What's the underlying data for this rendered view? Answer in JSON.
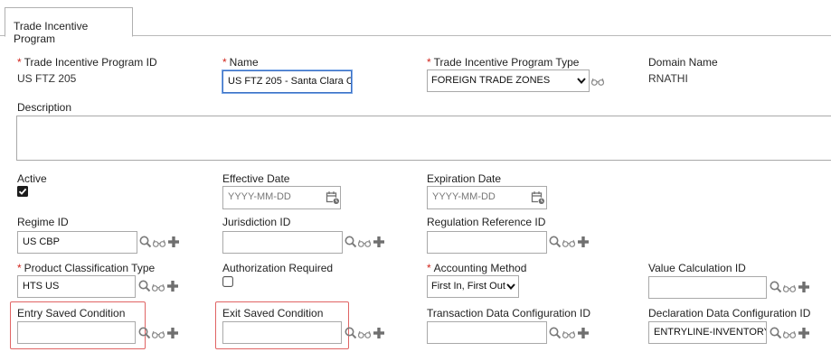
{
  "tabs": [
    {
      "label": "Trade Incentive Program"
    }
  ],
  "fields": {
    "program_id": {
      "label": "Trade Incentive Program ID",
      "value": "US FTZ 205"
    },
    "name": {
      "label": "Name",
      "value": "US FTZ 205 - Santa Clara C"
    },
    "program_type": {
      "label": "Trade Incentive Program Type",
      "value": "FOREIGN TRADE ZONES"
    },
    "domain_name": {
      "label": "Domain Name",
      "value": "RNATHI"
    },
    "description": {
      "label": "Description",
      "value": ""
    },
    "active": {
      "label": "Active",
      "checked": true
    },
    "effective_date": {
      "label": "Effective Date",
      "placeholder": "YYYY-MM-DD"
    },
    "expiration_date": {
      "label": "Expiration Date",
      "placeholder": "YYYY-MM-DD"
    },
    "regime_id": {
      "label": "Regime ID",
      "value": "US CBP"
    },
    "jurisdiction_id": {
      "label": "Jurisdiction ID",
      "value": ""
    },
    "regulation_reference_id": {
      "label": "Regulation Reference ID",
      "value": ""
    },
    "product_classification_type": {
      "label": "Product Classification Type",
      "value": "HTS US"
    },
    "authorization_required": {
      "label": "Authorization Required",
      "checked": false
    },
    "accounting_method": {
      "label": "Accounting Method",
      "value": "First In, First Out"
    },
    "value_calculation_id": {
      "label": "Value Calculation ID",
      "value": ""
    },
    "entry_saved_condition": {
      "label": "Entry Saved Condition",
      "value": ""
    },
    "exit_saved_condition": {
      "label": "Exit Saved Condition",
      "value": ""
    },
    "transaction_data_configuration_id": {
      "label": "Transaction Data Configuration ID",
      "value": ""
    },
    "declaration_data_configuration_id": {
      "label": "Declaration Data Configuration ID",
      "value": "ENTRYLINE-INVENTORY"
    }
  },
  "required_marker": "*",
  "colors": {
    "required": "#d0251c",
    "highlight": "#e06464",
    "focus": "#3a70c4",
    "icon": "#7a7a7a"
  },
  "icons": [
    "search-icon",
    "view-icon",
    "add-icon",
    "calendar-icon",
    "chevron-down-icon",
    "checkbox-icon"
  ]
}
